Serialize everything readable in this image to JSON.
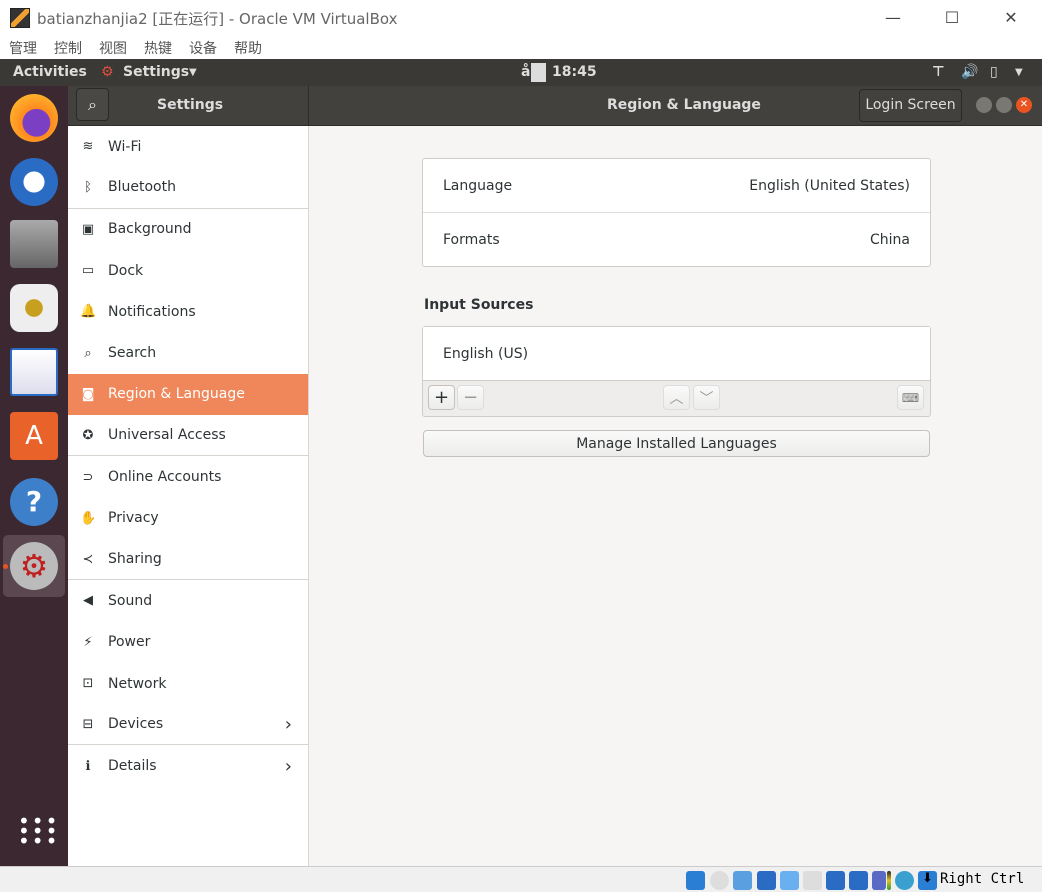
{
  "window": {
    "title": "batianzhanjia2 [正在运行] - Oracle VM VirtualBox",
    "menu": [
      "管理",
      "控制",
      "视图",
      "热键",
      "设备",
      "帮助"
    ]
  },
  "topbar": {
    "activities": "Activities",
    "app": "Settings",
    "clock": "18:45",
    "indicator": "å"
  },
  "header": {
    "sidebar_title": "Settings",
    "title": "Region & Language",
    "login_screen": "Login Screen"
  },
  "sidebar": {
    "items": [
      {
        "label": "Wi-Fi",
        "icon": "wifi-icon",
        "glyph": "≋"
      },
      {
        "label": "Bluetooth",
        "icon": "bluetooth-icon",
        "glyph": "ᛒ"
      },
      {
        "label": "Background",
        "icon": "background-icon",
        "glyph": "▣"
      },
      {
        "label": "Dock",
        "icon": "dock-icon",
        "glyph": "▭"
      },
      {
        "label": "Notifications",
        "icon": "bell-icon",
        "glyph": "🔔"
      },
      {
        "label": "Search",
        "icon": "search-icon",
        "glyph": "⌕"
      },
      {
        "label": "Region & Language",
        "icon": "camera-icon",
        "glyph": "◙"
      },
      {
        "label": "Universal Access",
        "icon": "accessibility-icon",
        "glyph": "✪"
      },
      {
        "label": "Online Accounts",
        "icon": "online-accounts-icon",
        "glyph": "⊃"
      },
      {
        "label": "Privacy",
        "icon": "hand-icon",
        "glyph": "✋"
      },
      {
        "label": "Sharing",
        "icon": "share-icon",
        "glyph": "≺"
      },
      {
        "label": "Sound",
        "icon": "speaker-icon",
        "glyph": "◀"
      },
      {
        "label": "Power",
        "icon": "power-icon",
        "glyph": "⚡"
      },
      {
        "label": "Network",
        "icon": "network-icon",
        "glyph": "⊡"
      },
      {
        "label": "Devices",
        "icon": "devices-icon",
        "glyph": "⊟",
        "chevron": "›"
      },
      {
        "label": "Details",
        "icon": "info-icon",
        "glyph": "ℹ",
        "chevron": "›"
      }
    ]
  },
  "region": {
    "language_label": "Language",
    "language_value": "English (United States)",
    "formats_label": "Formats",
    "formats_value": "China",
    "input_sources_heading": "Input Sources",
    "input_sources": [
      "English (US)"
    ],
    "manage_button": "Manage Installed Languages"
  },
  "statusbar": {
    "host_key": "Right Ctrl"
  }
}
